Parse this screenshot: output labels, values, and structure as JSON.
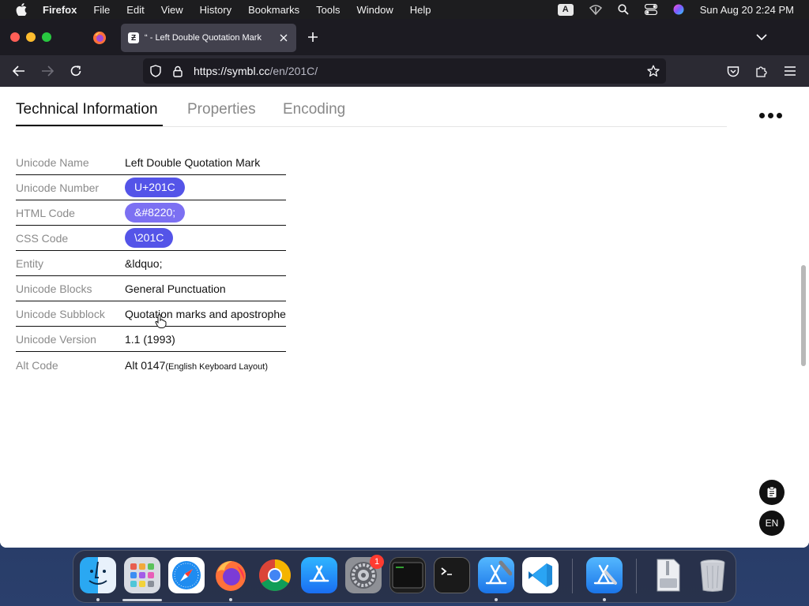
{
  "menubar": {
    "app_name": "Firefox",
    "items": [
      "File",
      "Edit",
      "View",
      "History",
      "Bookmarks",
      "Tools",
      "Window",
      "Help"
    ],
    "input_source": "A",
    "clock": "Sun Aug 20  2:24 PM"
  },
  "browser": {
    "tab_title": "“ - Left Double Quotation Mark",
    "tab_favicon": "Ƶ",
    "url_host": "https://symbl.cc",
    "url_path": "/en/201C/"
  },
  "page": {
    "tabs": [
      "Technical Information",
      "Properties",
      "Encoding"
    ],
    "active_tab": "Technical Information",
    "rows": [
      {
        "label": "Unicode Name",
        "value": "Left Double Quotation Mark"
      },
      {
        "label": "Unicode Number",
        "value": "U+201C"
      },
      {
        "label": "HTML Code",
        "value": "&#8220;"
      },
      {
        "label": "CSS Code",
        "value": "\\201C"
      },
      {
        "label": "Entity",
        "value": "&ldquo;"
      },
      {
        "label": "Unicode Blocks",
        "value": "General Punctuation"
      },
      {
        "label": "Unicode Subblock",
        "value": "Quotation marks and apostrophe"
      },
      {
        "label": "Unicode Version",
        "value": "1.1 (1993)"
      },
      {
        "label": "Alt Code",
        "value": "Alt 0147",
        "note": "(English Keyboard Layout)"
      }
    ],
    "lang_button": "EN"
  },
  "dock": {
    "items": [
      "finder-icon",
      "launchpad-icon",
      "safari-icon",
      "firefox-icon",
      "chrome-icon",
      "app-store-icon",
      "system-settings-icon",
      "console-icon",
      "terminal-icon",
      "xcode-icon",
      "vscode-icon",
      "simulator-icon",
      "archive-icon",
      "trash-icon"
    ],
    "settings_badge": "1"
  },
  "colors": {
    "pill_primary": "#5454e8",
    "pill_light": "#7c70f2",
    "browser_chrome": "#1c1b22"
  }
}
